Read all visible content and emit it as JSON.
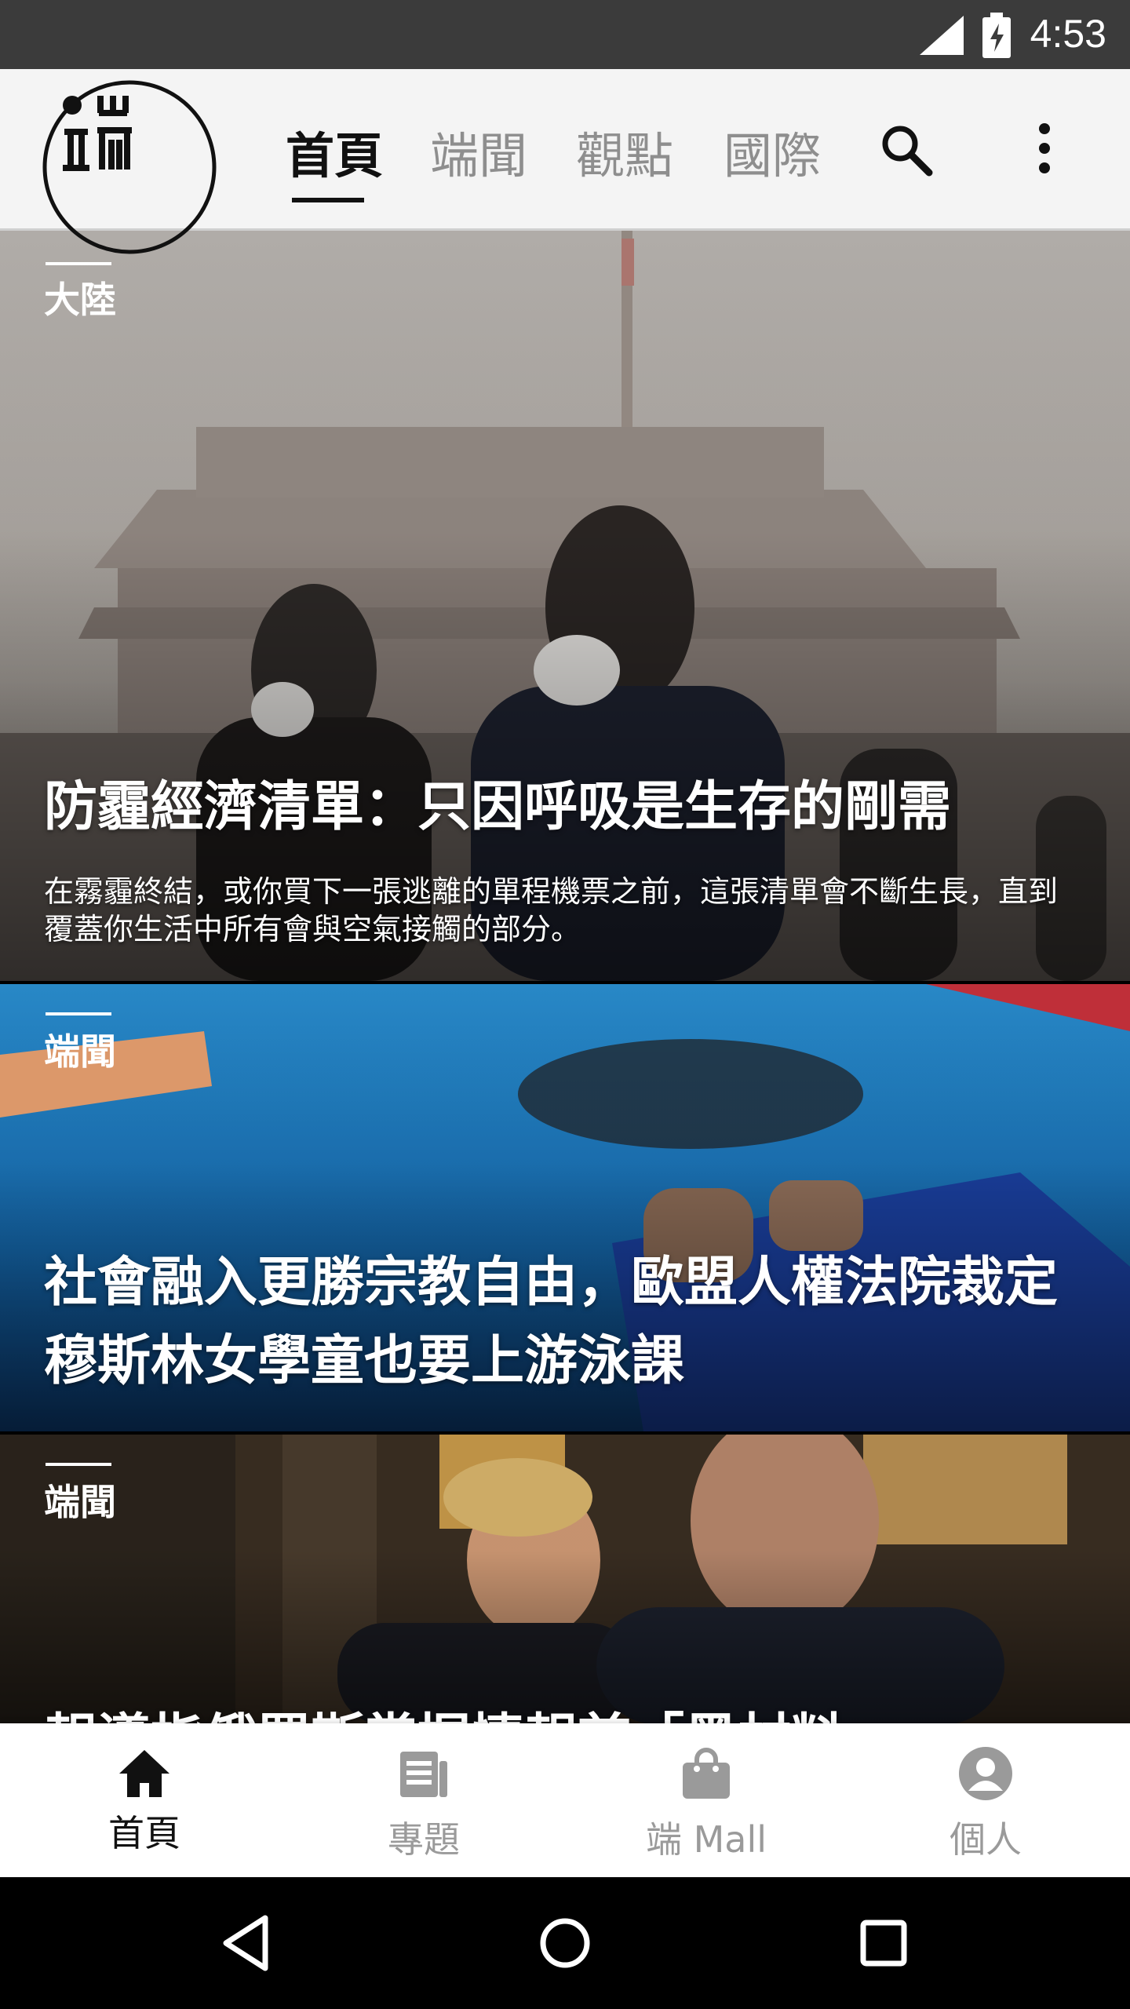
{
  "status_bar": {
    "time": "4:53"
  },
  "app_bar": {
    "tabs": [
      {
        "label": "首頁",
        "active": true
      },
      {
        "label": "端聞",
        "active": false
      },
      {
        "label": "觀點",
        "active": false
      },
      {
        "label": "國際",
        "active": false
      }
    ],
    "icons": [
      "logo-icon",
      "search-icon",
      "more-vert-icon"
    ]
  },
  "articles": [
    {
      "category": "大陸",
      "headline": "防霾經濟清單：只因呼吸是生存的剛需",
      "summary": "在霧霾終結，或你買下一張逃離的單程機票之前，這張清單會不斷生長，直到覆蓋你生活中所有會與空氣接觸的部分。"
    },
    {
      "category": "端聞",
      "headline": "社會融入更勝宗教自由，歐盟人權法院裁定穆斯林女學童也要上游泳課"
    },
    {
      "category": "端聞",
      "headline": "報導指俄羅斯掌握情報首「黑材料」"
    }
  ],
  "bottom_nav": {
    "items": [
      {
        "label": "首頁",
        "icon": "home-icon",
        "active": true
      },
      {
        "label": "專題",
        "icon": "topics-icon",
        "active": false
      },
      {
        "label": "端 Mall",
        "icon": "shopping-bag-icon",
        "active": false
      },
      {
        "label": "個人",
        "icon": "account-icon",
        "active": false
      }
    ]
  },
  "system_nav": [
    "back-icon",
    "home-circle-icon",
    "recents-icon"
  ],
  "colors": {
    "active": "#111111",
    "inactive": "#9a9a9a",
    "status_bar": "#3b3b3b"
  }
}
